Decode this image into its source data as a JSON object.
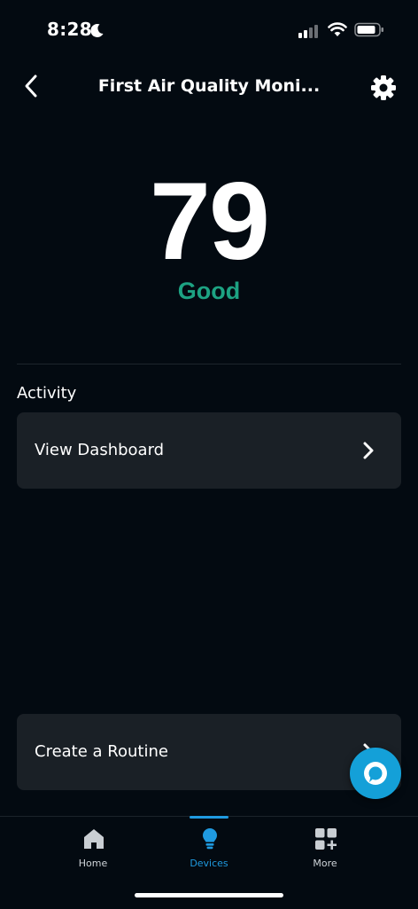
{
  "status_bar": {
    "time": "8:28"
  },
  "header": {
    "title": "First Air Quality Moni..."
  },
  "air_quality": {
    "score": "79",
    "rating": "Good",
    "rating_color": "#1da383"
  },
  "activity": {
    "section_title": "Activity",
    "dashboard_label": "View Dashboard"
  },
  "routine": {
    "label": "Create a Routine"
  },
  "tabs": [
    {
      "label": "Home",
      "icon": "home-icon",
      "active": false
    },
    {
      "label": "Devices",
      "icon": "lightbulb-icon",
      "active": true
    },
    {
      "label": "More",
      "icon": "more-grid-icon",
      "active": false
    }
  ],
  "colors": {
    "background": "#030a11",
    "card": "#1a2026",
    "accent": "#1f9ae0",
    "alexa": "#14a0d8"
  }
}
